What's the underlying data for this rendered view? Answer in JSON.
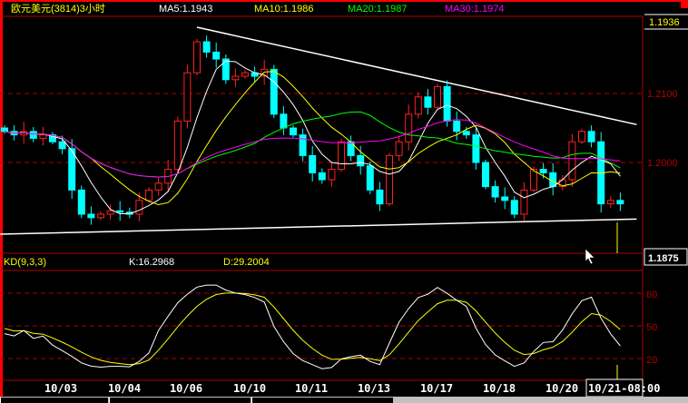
{
  "header": {
    "title": "欧元美元(3814)3小时",
    "ma5": "MA5:1.1943",
    "ma10": "MA10:1.1986",
    "ma20": "MA20:1.1987",
    "ma30": "MA30:1.1974"
  },
  "price_axis": {
    "top_value": "1.1936",
    "levels": [
      "1.2100",
      "1.2000"
    ],
    "cursor_value": "1.1875"
  },
  "kd": {
    "title": "KD(9,3,3)",
    "k": "K:16.2968",
    "d": "D:29.2004",
    "levels": [
      "80",
      "50",
      "20"
    ]
  },
  "dates": [
    "10/03",
    "10/04",
    "10/06",
    "10/10",
    "10/11",
    "10/13",
    "10/17",
    "10/18",
    "10/20"
  ],
  "cursor_date": "10/21-08:00",
  "colors": {
    "up": "#ff2020",
    "down": "#00ffff",
    "ma5": "#ffffff",
    "ma10": "#ffff00",
    "ma20": "#00ff00",
    "ma30": "#ff00ff",
    "grid": "#b00000"
  },
  "chart_data": {
    "type": "candlestick",
    "closes": [
      1.2045,
      1.204,
      1.2045,
      1.2035,
      1.204,
      1.203,
      1.202,
      1.196,
      1.1925,
      1.192,
      1.1925,
      1.193,
      1.1928,
      1.1925,
      1.1945,
      1.196,
      1.197,
      1.199,
      1.206,
      1.213,
      1.2175,
      1.216,
      1.215,
      1.212,
      1.2125,
      1.213,
      1.2125,
      1.2135,
      1.207,
      1.205,
      1.204,
      1.201,
      1.1985,
      1.1975,
      1.199,
      1.203,
      1.201,
      1.1995,
      1.196,
      1.194,
      1.201,
      1.203,
      1.207,
      1.2095,
      1.208,
      1.211,
      1.206,
      1.2045,
      1.204,
      1.2,
      1.1965,
      1.195,
      1.1945,
      1.1925,
      1.196,
      1.199,
      1.1985,
      1.1965,
      1.1975,
      1.203,
      1.2045,
      1.203,
      1.194,
      1.1945,
      1.194
    ],
    "ma_periods": [
      5,
      10,
      20,
      30
    ],
    "kd_params": [
      9,
      3,
      3
    ],
    "trendlines": [
      {
        "name": "upper",
        "from": [
          20,
          1.2196
        ],
        "to": [
          65.7,
          1.2055
        ]
      },
      {
        "name": "lower",
        "from": [
          -0.5,
          1.1896
        ],
        "to": [
          65.7,
          1.1918
        ]
      }
    ],
    "ylim": [
      1.1875,
      1.2215
    ],
    "kd_ylim": [
      0,
      100
    ]
  }
}
